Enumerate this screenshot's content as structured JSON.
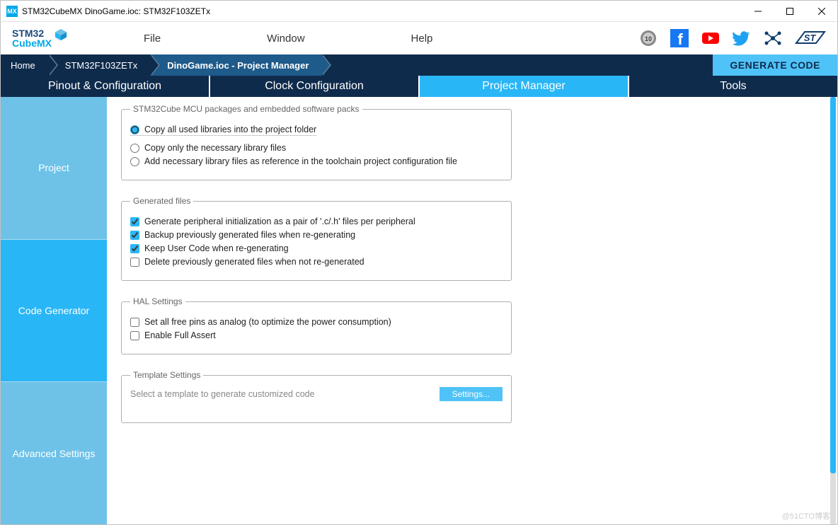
{
  "window": {
    "title": "STM32CubeMX DinoGame.ioc: STM32F103ZETx",
    "app_badge": "MX"
  },
  "menu": {
    "file": "File",
    "window": "Window",
    "help": "Help"
  },
  "logo": {
    "line1": "STM32",
    "line2": "CubeMX"
  },
  "breadcrumb": {
    "home": "Home",
    "chip": "STM32F103ZETx",
    "page": "DinoGame.ioc - Project Manager"
  },
  "generate_btn": "GENERATE CODE",
  "main_tabs": {
    "pinout": "Pinout & Configuration",
    "clock": "Clock Configuration",
    "pm": "Project Manager",
    "tools": "Tools"
  },
  "side_tabs": {
    "project": "Project",
    "codegen": "Code Generator",
    "advanced": "Advanced Settings"
  },
  "groups": {
    "packs": {
      "legend": "STM32Cube MCU packages and embedded software packs",
      "opt1": "Copy all used libraries into the project folder",
      "opt2": "Copy only the necessary library files",
      "opt3": "Add necessary library files as reference in the toolchain project configuration file"
    },
    "genfiles": {
      "legend": "Generated files",
      "c1": "Generate peripheral initialization as a pair of '.c/.h' files per peripheral",
      "c2": "Backup previously generated files when re-generating",
      "c3": "Keep User Code when re-generating",
      "c4": "Delete previously generated files when not re-generated"
    },
    "hal": {
      "legend": "HAL Settings",
      "c1": "Set all free pins as analog (to optimize the power consumption)",
      "c2": "Enable Full Assert"
    },
    "tmpl": {
      "legend": "Template Settings",
      "text": "Select a template to generate customized code",
      "btn": "Settings..."
    }
  },
  "watermark": "@51CTO博客"
}
